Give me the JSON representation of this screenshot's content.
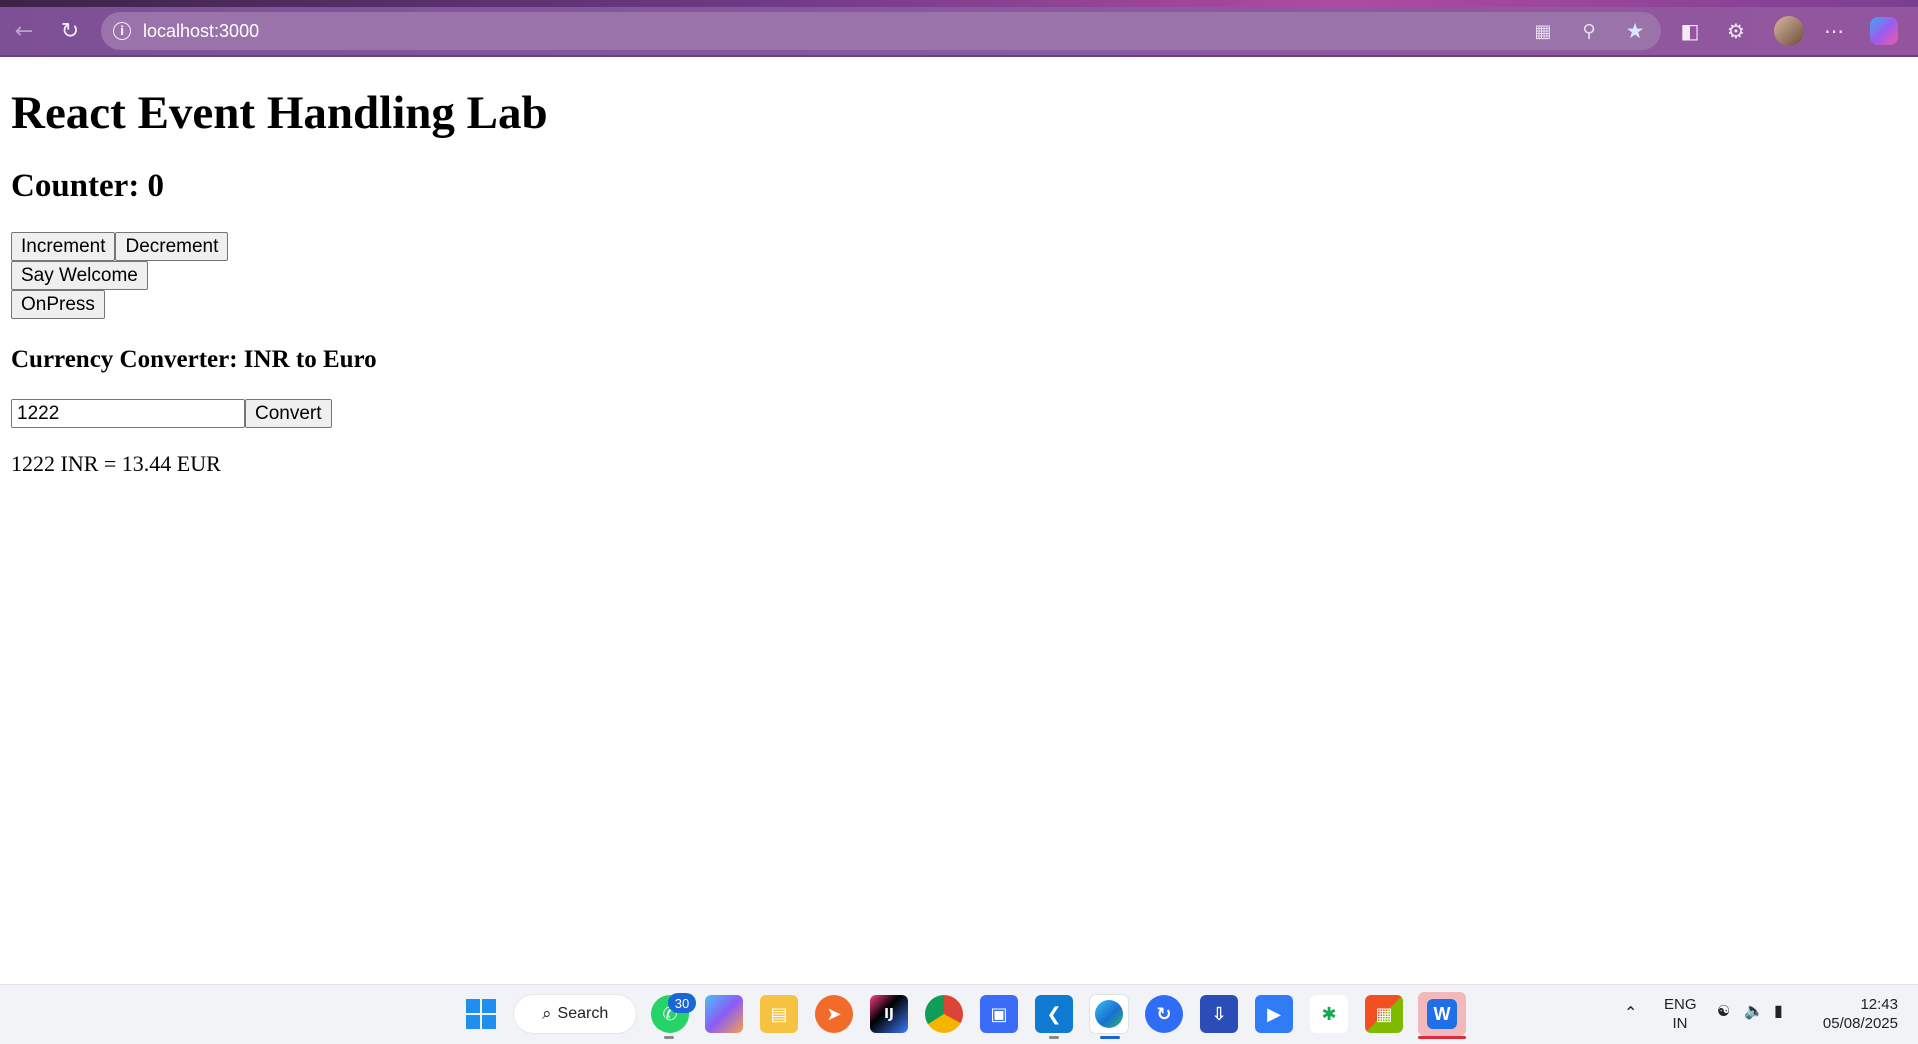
{
  "browser": {
    "url": "localhost:3000",
    "icons": {
      "back": "back-arrow-icon",
      "reload": "reload-icon",
      "site_info": "info-icon",
      "app_view": "app-grid-icon",
      "zoom": "zoom-icon",
      "favorite": "star-icon",
      "collections": "collections-icon",
      "extensions": "puzzle-icon",
      "profile": "avatar",
      "menu": "ellipsis-icon",
      "copilot": "copilot-icon"
    }
  },
  "page": {
    "title": "React Event Handling Lab",
    "counter_label": "Counter: 0",
    "buttons": {
      "increment": "Increment",
      "decrement": "Decrement",
      "welcome": "Say Welcome",
      "onpress": "OnPress"
    },
    "converter": {
      "heading": "Currency Converter: INR to Euro",
      "input_value": "1222",
      "convert_label": "Convert",
      "result": "1222 INR = 13.44 EUR"
    }
  },
  "taskbar": {
    "search_label": "Search",
    "whatsapp_badge": "30",
    "lang_line1": "ENG",
    "lang_line2": "IN",
    "time": "12:43",
    "date": "05/08/2025"
  },
  "colors": {
    "browser_frame": "#8a5aa0",
    "address_bar": "#9a73ab"
  }
}
